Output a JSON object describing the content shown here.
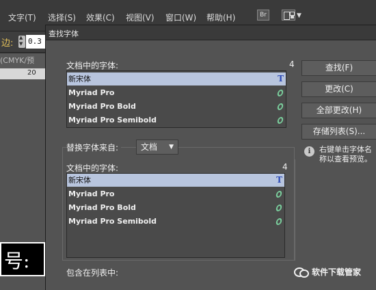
{
  "app": {
    "menus": [
      "文字(T)",
      "选择(S)",
      "效果(C)",
      "视图(V)",
      "窗口(W)",
      "帮助(H)"
    ],
    "bridge_icon_label": "Br",
    "edge_label": "边:",
    "stroke_value": "0.3",
    "doc_tab": "(CMYK/预",
    "ruler_tick": "20",
    "canvas_text": "号:"
  },
  "dialog": {
    "title": "查找字体",
    "doc_fonts_label": "文档中的字体:",
    "doc_fonts_count": "4",
    "doc_fonts": [
      {
        "name": "新宋体",
        "icon": "truetype-icon",
        "selected": true
      },
      {
        "name": "Myriad Pro",
        "icon": "opentype-icon",
        "selected": false
      },
      {
        "name": "Myriad Pro Bold",
        "icon": "opentype-icon",
        "selected": false
      },
      {
        "name": "Myriad Pro Semibold",
        "icon": "opentype-icon",
        "selected": false
      }
    ],
    "replace_from_label": "替换字体来自:",
    "replace_from_value": "文档",
    "replace_fonts_label": "文档中的字体:",
    "replace_fonts_count": "4",
    "replace_fonts": [
      {
        "name": "新宋体",
        "icon": "truetype-icon",
        "selected": true
      },
      {
        "name": "Myriad Pro",
        "icon": "opentype-icon",
        "selected": false
      },
      {
        "name": "Myriad Pro Bold",
        "icon": "opentype-icon",
        "selected": false
      },
      {
        "name": "Myriad Pro Semibold",
        "icon": "opentype-icon",
        "selected": false
      }
    ],
    "include_label": "包含在列表中:",
    "buttons": {
      "find": "查找(F)",
      "change": "更改(C)",
      "change_all": "全部更改(H)",
      "save_list": "存储列表(S)..."
    },
    "info_text": "右键单击字体名称以查看预览。"
  },
  "watermark": "软件下载管家"
}
